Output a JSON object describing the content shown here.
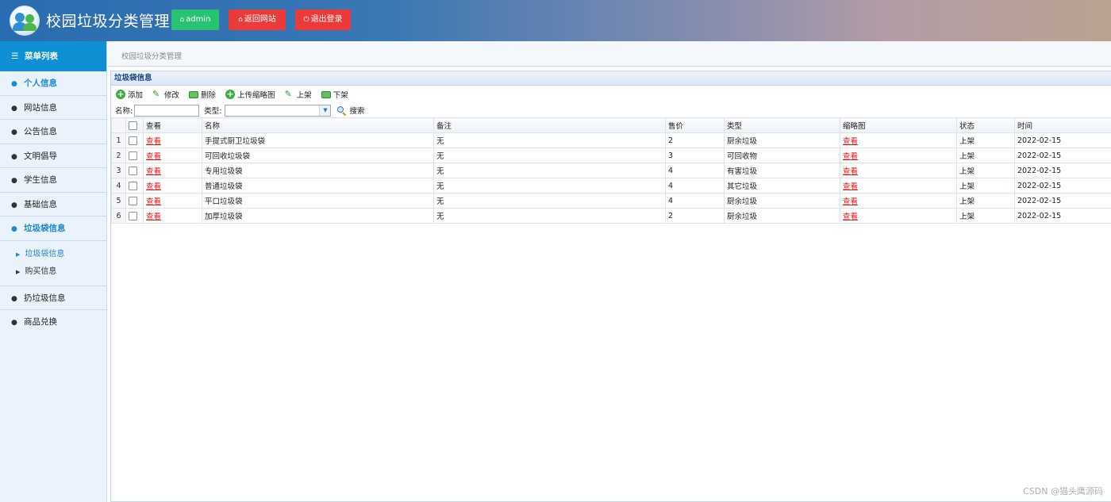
{
  "header": {
    "title": "校园垃圾分类管理",
    "admin_label": "admin",
    "back_label": "返回网站",
    "logout_label": "退出登录"
  },
  "sidebar": {
    "head": "菜单列表",
    "items": [
      {
        "label": "个人信息",
        "active": true
      },
      {
        "label": "网站信息"
      },
      {
        "label": "公告信息"
      },
      {
        "label": "文明倡导"
      },
      {
        "label": "学生信息"
      },
      {
        "label": "基础信息"
      },
      {
        "label": "垃圾袋信息",
        "active": true
      },
      {
        "label": "扔垃圾信息"
      },
      {
        "label": "商品兑换"
      }
    ],
    "sub_items": [
      {
        "label": "垃圾袋信息",
        "active": true
      },
      {
        "label": "购买信息"
      }
    ]
  },
  "breadcrumb": "校园垃圾分类管理",
  "panel": {
    "title": "垃圾袋信息",
    "toolbar": {
      "add": "添加",
      "edit": "修改",
      "delete": "删除",
      "upload": "上传缩略图",
      "list_on": "上架",
      "list_off": "下架"
    },
    "search": {
      "name_label": "名称:",
      "name_value": "",
      "type_label": "类型:",
      "type_value": "",
      "button": "搜索"
    },
    "table": {
      "columns": [
        "查看",
        "名称",
        "备注",
        "售价",
        "类型",
        "缩略图",
        "状态",
        "时间"
      ],
      "rows": [
        {
          "n": "1",
          "view": "查看",
          "name": "手提式厨卫垃圾袋",
          "note": "无",
          "price": "2",
          "type": "厨余垃圾",
          "thumb": "查看",
          "status": "上架",
          "time": "2022-02-15"
        },
        {
          "n": "2",
          "view": "查看",
          "name": "可回收垃圾袋",
          "note": "无",
          "price": "3",
          "type": "可回收物",
          "thumb": "查看",
          "status": "上架",
          "time": "2022-02-15"
        },
        {
          "n": "3",
          "view": "查看",
          "name": "专用垃圾袋",
          "note": "无",
          "price": "4",
          "type": "有害垃圾",
          "thumb": "查看",
          "status": "上架",
          "time": "2022-02-15"
        },
        {
          "n": "4",
          "view": "查看",
          "name": "普通垃圾袋",
          "note": "无",
          "price": "4",
          "type": "其它垃圾",
          "thumb": "查看",
          "status": "上架",
          "time": "2022-02-15"
        },
        {
          "n": "5",
          "view": "查看",
          "name": "平口垃圾袋",
          "note": "无",
          "price": "4",
          "type": "厨余垃圾",
          "thumb": "查看",
          "status": "上架",
          "time": "2022-02-15"
        },
        {
          "n": "6",
          "view": "查看",
          "name": "加厚垃圾袋",
          "note": "无",
          "price": "2",
          "type": "厨余垃圾",
          "thumb": "查看",
          "status": "上架",
          "time": "2022-02-15"
        }
      ]
    }
  },
  "watermark": "CSDN @猫头鹰源码",
  "colors": {
    "accent": "#0f8fd4",
    "green_button": "#27c272",
    "red_button": "#ea3a3a",
    "link": "#e31b1b"
  }
}
